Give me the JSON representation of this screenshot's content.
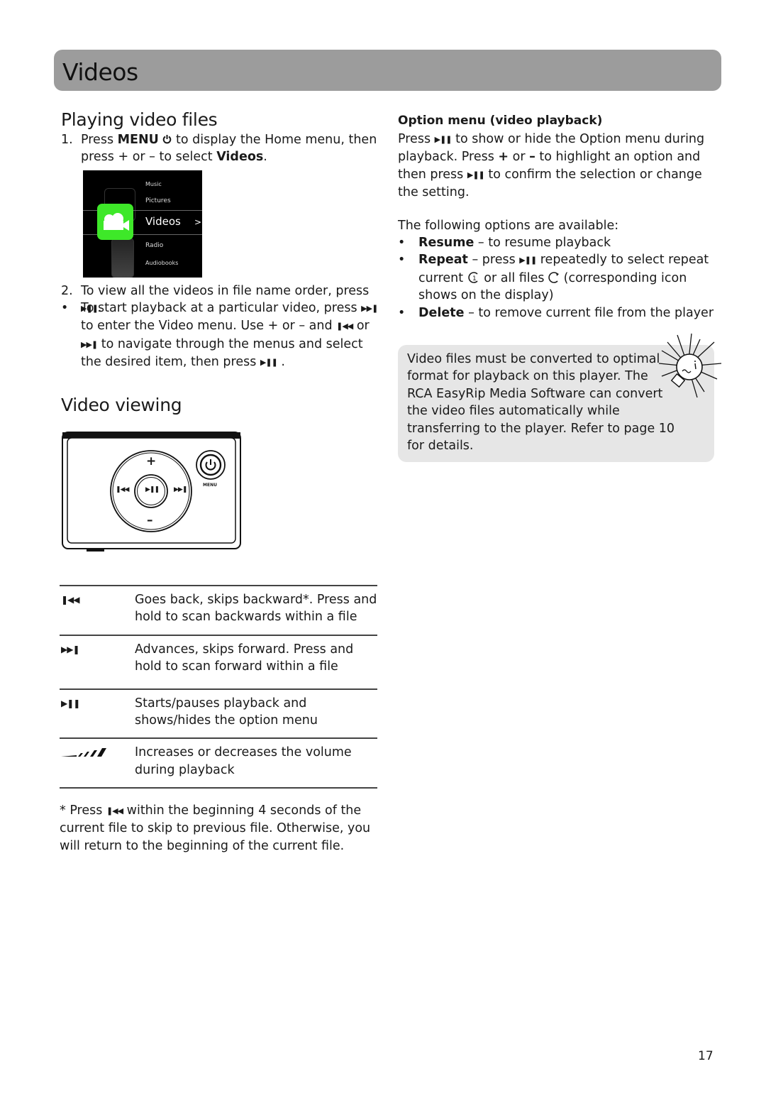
{
  "header": {
    "title": "Videos"
  },
  "playing": {
    "title": "Playing video files",
    "step1": {
      "num": "1.",
      "t1": "Press ",
      "menu_label": "MENU",
      "t2": " to display the Home menu, then press + or – to select ",
      "videos_label": "Videos",
      "t3": "."
    },
    "menu_screen": {
      "items": [
        "Music",
        "Pictures",
        "Videos",
        "Radio",
        "Audiobooks"
      ],
      "selected": "Videos",
      "arrow": ">",
      "accent": "#3ee829"
    },
    "step2": {
      "num": "2.",
      "text": "To view all the videos in file name order, press ",
      "end": "."
    },
    "bullet": {
      "t1": "To start playback at a particular video, press ",
      "t2": " to enter the Video menu. Use + or – and ",
      "t3": " or ",
      "t4": " to navigate through the menus and select the desired item, then press ",
      "t5": " ."
    }
  },
  "viewing": {
    "title": "Video viewing",
    "device": {
      "plus": "+",
      "minus": "–",
      "menu_label": "MENU"
    },
    "buttons": [
      {
        "icon": "skip-back-icon",
        "glyph": "⏮",
        "desc": "Goes back, skips backward*. Press and hold to scan backwards within a file"
      },
      {
        "icon": "skip-forward-icon",
        "glyph": "⏭",
        "desc": "Advances, skips forward. Press and hold to scan forward within a file"
      },
      {
        "icon": "play-pause-icon",
        "glyph": "▶❙❙",
        "desc": "Starts/pauses playback and shows/hides the option menu"
      },
      {
        "icon": "volume-icon",
        "glyph": "",
        "desc": "Increases or decreases the volume during playback"
      }
    ],
    "footnote": {
      "t1": "* Press ",
      "t2": " within the beginning 4 seconds of the current file to skip to previous file. Otherwise, you will return to the beginning of the current file."
    }
  },
  "option_menu": {
    "title": "Option menu (video playback)",
    "p1": {
      "t1": "Press ",
      "t2": " to show or hide the Option menu during playback. Press ",
      "plus": "+",
      "t3": " or ",
      "minus": "–",
      "t4": " to highlight an option and then press ",
      "t5": " to confirm the selection or change the setting."
    },
    "intro": "The following options are available:",
    "options": [
      {
        "name": "Resume",
        "desc": " – to resume playback"
      },
      {
        "name": "Repeat",
        "desc_a": " – press ",
        "desc_b": " repeatedly to select repeat current ",
        "desc_c": " or all files ",
        "desc_d": " (corresponding icon shows on the display)"
      },
      {
        "name": "Delete",
        "desc": " – to remove current file from the player"
      }
    ]
  },
  "tip": {
    "text": "Video files must be converted to optimal format for playback on this player. The RCA EasyRip Media Software can convert the video files automatically while transferring to the player. Refer to page 10 for details.",
    "bg_color": "#e6e6e6"
  },
  "page_number": "17"
}
